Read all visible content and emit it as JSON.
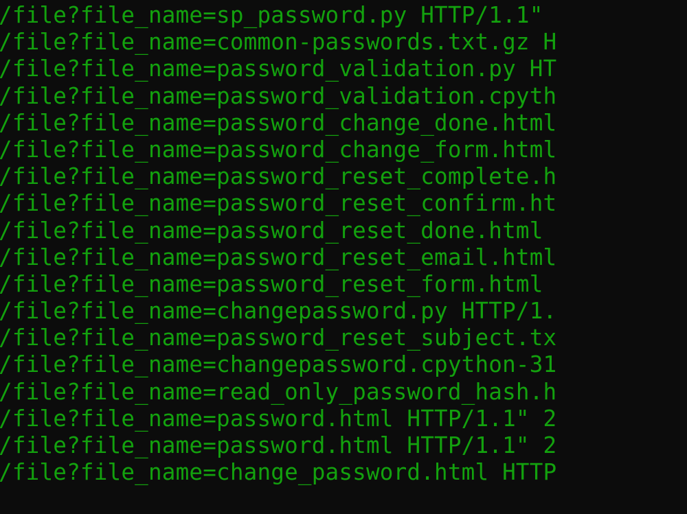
{
  "terminal": {
    "text_color": "#13a10e",
    "background_color": "#0c0c0c",
    "lines": [
      "/file?file_name=sp_password.py HTTP/1.1\"",
      "/file?file_name=common-passwords.txt.gz H",
      "/file?file_name=password_validation.py HT",
      "/file?file_name=password_validation.cpyth",
      "/file?file_name=password_change_done.html",
      "/file?file_name=password_change_form.html",
      "/file?file_name=password_reset_complete.h",
      "/file?file_name=password_reset_confirm.ht",
      "/file?file_name=password_reset_done.html ",
      "/file?file_name=password_reset_email.html",
      "/file?file_name=password_reset_form.html ",
      "/file?file_name=changepassword.py HTTP/1.",
      "/file?file_name=password_reset_subject.tx",
      "/file?file_name=changepassword.cpython-31",
      "/file?file_name=read_only_password_hash.h",
      "/file?file_name=password.html HTTP/1.1\" 2",
      "/file?file_name=password.html HTTP/1.1\" 2",
      "/file?file_name=change_password.html HTTP"
    ]
  }
}
